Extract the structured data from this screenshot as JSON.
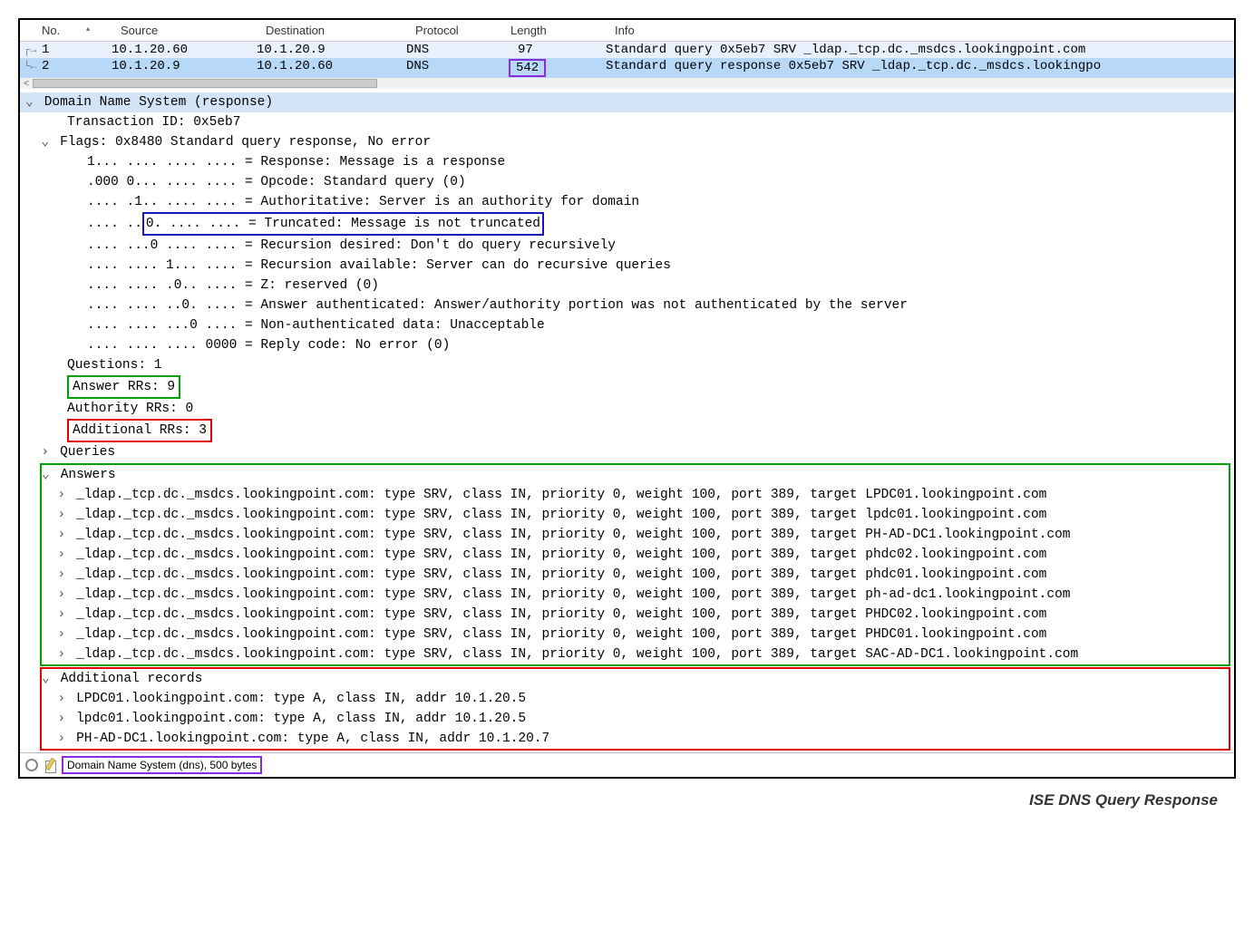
{
  "packetList": {
    "headers": {
      "no": "No.",
      "source": "Source",
      "destination": "Destination",
      "protocol": "Protocol",
      "length": "Length",
      "info": "Info"
    },
    "rows": [
      {
        "no": "1",
        "source": "10.1.20.60",
        "destination": "10.1.20.9",
        "protocol": "DNS",
        "length": "97",
        "info": "Standard query 0x5eb7 SRV _ldap._tcp.dc._msdcs.lookingpoint.com"
      },
      {
        "no": "2",
        "source": "10.1.20.9",
        "destination": "10.1.20.60",
        "protocol": "DNS",
        "length": "542",
        "info": "Standard query response 0x5eb7 SRV _ldap._tcp.dc._msdcs.lookingpo"
      }
    ]
  },
  "detail": {
    "title": "Domain Name System (response)",
    "txid": "Transaction ID: 0x5eb7",
    "flagsHeader": "Flags: 0x8480 Standard query response, No error",
    "flags": {
      "response": "1... .... .... .... = Response: Message is a response",
      "opcode": ".000 0... .... .... = Opcode: Standard query (0)",
      "auth": ".... .1.. .... .... = Authoritative: Server is an authority for domain",
      "truncPre": ".... ..",
      "truncBox": "0. .... .... = Truncated: Message is not truncated",
      "recDes": ".... ...0 .... .... = Recursion desired: Don't do query recursively",
      "recAvail": ".... .... 1... .... = Recursion available: Server can do recursive queries",
      "z": ".... .... .0.. .... = Z: reserved (0)",
      "ansAuth": ".... .... ..0. .... = Answer authenticated: Answer/authority portion was not authenticated by the server",
      "nonAuth": ".... .... ...0 .... = Non-authenticated data: Unacceptable",
      "reply": ".... .... .... 0000 = Reply code: No error (0)"
    },
    "questions": "Questions: 1",
    "answerRRs": "Answer RRs: 9",
    "authorityRRs": "Authority RRs: 0",
    "additionalRRs": "Additional RRs: 3",
    "queries": "Queries",
    "answersLabel": "Answers",
    "answers": [
      "_ldap._tcp.dc._msdcs.lookingpoint.com: type SRV, class IN, priority 0, weight 100, port 389, target LPDC01.lookingpoint.com",
      "_ldap._tcp.dc._msdcs.lookingpoint.com: type SRV, class IN, priority 0, weight 100, port 389, target lpdc01.lookingpoint.com",
      "_ldap._tcp.dc._msdcs.lookingpoint.com: type SRV, class IN, priority 0, weight 100, port 389, target PH-AD-DC1.lookingpoint.com",
      "_ldap._tcp.dc._msdcs.lookingpoint.com: type SRV, class IN, priority 0, weight 100, port 389, target phdc02.lookingpoint.com",
      "_ldap._tcp.dc._msdcs.lookingpoint.com: type SRV, class IN, priority 0, weight 100, port 389, target phdc01.lookingpoint.com",
      "_ldap._tcp.dc._msdcs.lookingpoint.com: type SRV, class IN, priority 0, weight 100, port 389, target ph-ad-dc1.lookingpoint.com",
      "_ldap._tcp.dc._msdcs.lookingpoint.com: type SRV, class IN, priority 0, weight 100, port 389, target PHDC02.lookingpoint.com",
      "_ldap._tcp.dc._msdcs.lookingpoint.com: type SRV, class IN, priority 0, weight 100, port 389, target PHDC01.lookingpoint.com",
      "_ldap._tcp.dc._msdcs.lookingpoint.com: type SRV, class IN, priority 0, weight 100, port 389, target SAC-AD-DC1.lookingpoint.com"
    ],
    "additionalLabel": "Additional records",
    "additional": [
      "LPDC01.lookingpoint.com: type A, class IN, addr 10.1.20.5",
      "lpdc01.lookingpoint.com: type A, class IN, addr 10.1.20.5",
      "PH-AD-DC1.lookingpoint.com: type A, class IN, addr 10.1.20.7"
    ]
  },
  "footer": {
    "label": "Domain Name System (dns), 500 bytes"
  },
  "caption": "ISE DNS Query Response"
}
